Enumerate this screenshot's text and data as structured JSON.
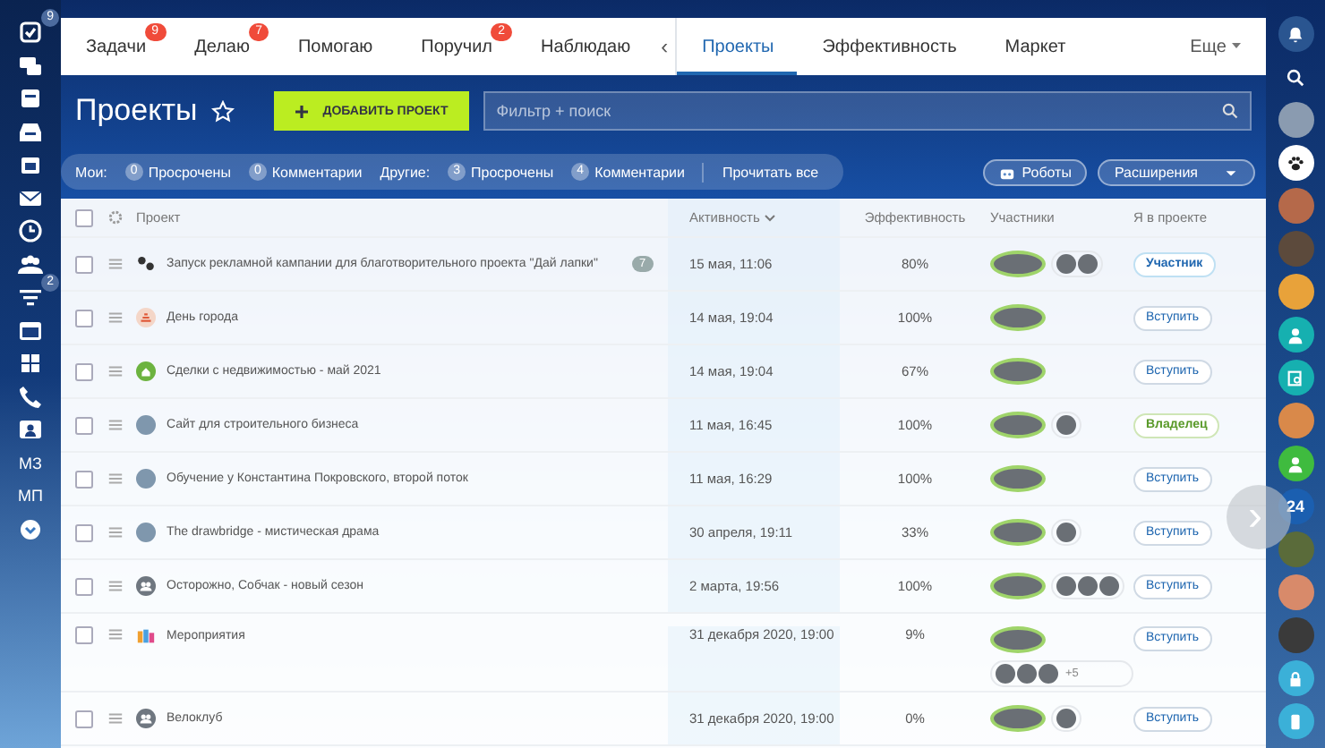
{
  "left_sidebar": [
    {
      "kind": "tasks",
      "badge": "9"
    },
    {
      "kind": "chat"
    },
    {
      "kind": "feed"
    },
    {
      "kind": "inbox"
    },
    {
      "kind": "calendar"
    },
    {
      "kind": "mail"
    },
    {
      "kind": "clock"
    },
    {
      "kind": "people"
    },
    {
      "kind": "filter",
      "badge": "2"
    },
    {
      "kind": "window"
    },
    {
      "kind": "apps"
    },
    {
      "kind": "phone"
    },
    {
      "kind": "contact"
    },
    {
      "kind": "text",
      "label": "МЗ"
    },
    {
      "kind": "text",
      "label": "МП"
    },
    {
      "kind": "chevron"
    }
  ],
  "right_sidebar": [
    {
      "kind": "bell"
    },
    {
      "kind": "search"
    },
    {
      "kind": "avatar",
      "color": "#8a9bb0"
    },
    {
      "kind": "paw"
    },
    {
      "kind": "avatar",
      "color": "#b5694a"
    },
    {
      "kind": "avatar",
      "color": "#5c4a3c"
    },
    {
      "kind": "avatar",
      "color": "#e8a23a"
    },
    {
      "kind": "person",
      "color": "#16b0b0"
    },
    {
      "kind": "doc",
      "color": "#16b0b0"
    },
    {
      "kind": "avatar",
      "color": "#d9894a"
    },
    {
      "kind": "person",
      "color": "#3fbb3f"
    },
    {
      "kind": "text",
      "label": "24"
    },
    {
      "kind": "avatar",
      "color": "#5a6b3a"
    },
    {
      "kind": "avatar",
      "color": "#d88a6a"
    },
    {
      "kind": "avatar",
      "color": "#3a3a3a"
    },
    {
      "kind": "lock",
      "color": "#3bb0d8"
    },
    {
      "kind": "phone",
      "color": "#3bb0d8"
    }
  ],
  "tabs": [
    {
      "label": "Задачи",
      "badge": "9",
      "selected": false
    },
    {
      "label": "Делаю",
      "badge": "7",
      "selected": false
    },
    {
      "label": "Помогаю",
      "selected": false
    },
    {
      "label": "Поручил",
      "badge": "2",
      "selected": false
    },
    {
      "label": "Наблюдаю",
      "selected": false
    }
  ],
  "tabs_toggle": "‹",
  "tabs_right": [
    {
      "label": "Проекты",
      "selected": true
    },
    {
      "label": "Эффективность",
      "selected": false
    },
    {
      "label": "Маркет",
      "selected": false
    }
  ],
  "more": "Еще",
  "page_title": "Проекты",
  "add_button": "ДОБАВИТЬ ПРОЕКТ",
  "search": {
    "placeholder": "Фильтр + поиск"
  },
  "counters": [
    {
      "kind": "label",
      "label": "Мои:"
    },
    {
      "kind": "counter",
      "count": "0",
      "label": "Просрочены"
    },
    {
      "kind": "counter",
      "count": "0",
      "label": "Комментарии"
    },
    {
      "kind": "label",
      "label": "Другие:"
    },
    {
      "kind": "counter",
      "count": "3",
      "label": "Просрочены"
    },
    {
      "kind": "counter",
      "count": "4",
      "label": "Комментарии"
    },
    {
      "kind": "action",
      "label": "Прочитать все"
    }
  ],
  "robots_button": "Роботы",
  "extensions_button": "Расширения",
  "table": {
    "select_all_checked": false,
    "columns": [
      "Проект",
      "Активность",
      "Эффективность",
      "Участники",
      "Я в проекте"
    ],
    "rows": [
      {
        "kind": "paws",
        "checked": false,
        "name": "Запуск рекламной кампании для благотворительного проекта \"Дай лапки\"",
        "comments": "7",
        "activity": "15 мая, 11:06",
        "efficiency": "80%",
        "members": [
          {
            "kind": "head"
          },
          {
            "kind": "member"
          },
          {
            "kind": "member"
          }
        ],
        "role": {
          "kind": "member",
          "label": "Участник"
        }
      },
      {
        "kind": "logo",
        "checked": false,
        "name": "День города",
        "activity": "14 мая, 19:04",
        "efficiency": "100%",
        "members": [
          {
            "kind": "head"
          }
        ],
        "role": {
          "kind": "join",
          "label": "Вступить"
        }
      },
      {
        "kind": "house",
        "checked": false,
        "name": "Сделки с недвижимостью - май 2021",
        "activity": "14 мая, 19:04",
        "efficiency": "67%",
        "members": [
          {
            "kind": "head"
          }
        ],
        "role": {
          "kind": "join",
          "label": "Вступить"
        }
      },
      {
        "kind": "photo",
        "checked": false,
        "name": "Сайт для строительного бизнеса",
        "activity": "11 мая, 16:45",
        "efficiency": "100%",
        "members": [
          {
            "kind": "head"
          },
          {
            "kind": "member"
          }
        ],
        "role": {
          "kind": "owner",
          "label": "Владелец"
        }
      },
      {
        "kind": "photo",
        "checked": false,
        "name": "Обучение у Константина Покровского, второй поток",
        "activity": "11 мая, 16:29",
        "efficiency": "100%",
        "members": [
          {
            "kind": "head"
          }
        ],
        "role": {
          "kind": "join",
          "label": "Вступить"
        }
      },
      {
        "kind": "photo",
        "checked": false,
        "name": "The drawbridge - мистическая драма",
        "activity": "30 апреля, 19:11",
        "efficiency": "33%",
        "members": [
          {
            "kind": "head"
          },
          {
            "kind": "member"
          }
        ],
        "role": {
          "kind": "join",
          "label": "Вступить"
        }
      },
      {
        "kind": "group",
        "checked": false,
        "name": "Осторожно, Собчак - новый сезон",
        "activity": "2 марта, 19:56",
        "efficiency": "100%",
        "members": [
          {
            "kind": "head"
          },
          {
            "kind": "member"
          },
          {
            "kind": "member"
          },
          {
            "kind": "member"
          }
        ],
        "role": {
          "kind": "join",
          "label": "Вступить"
        }
      },
      {
        "kind": "app",
        "checked": false,
        "name": "Мероприятия",
        "activity": "31 декабря 2020, 19:00",
        "efficiency": "9%",
        "members": [
          {
            "kind": "head"
          },
          {
            "kind": "member"
          },
          {
            "kind": "member"
          },
          {
            "kind": "member"
          }
        ],
        "members_more": "+5",
        "role": {
          "kind": "join",
          "label": "Вступить"
        }
      },
      {
        "kind": "group",
        "checked": false,
        "name": "Велоклуб",
        "activity": "31 декабря 2020, 19:00",
        "efficiency": "0%",
        "members": [
          {
            "kind": "head"
          },
          {
            "kind": "member"
          }
        ],
        "role": {
          "kind": "join",
          "label": "Вступить"
        }
      }
    ]
  },
  "scroll_arrow": "›"
}
